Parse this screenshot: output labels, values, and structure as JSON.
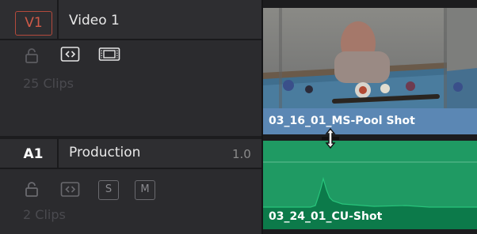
{
  "video_track": {
    "badge": "V1",
    "name": "Video 1",
    "clip_count": "25 Clips",
    "clip": {
      "label": "03_16_01_MS-Pool Shot"
    }
  },
  "audio_track": {
    "badge": "A1",
    "name": "Production",
    "level": "1.0",
    "clip_count": "2 Clips",
    "solo_label": "S",
    "mute_label": "M",
    "clip": {
      "label": "03_24_01_CU-Shot"
    }
  },
  "icons": {
    "lock": "lock-icon",
    "auto_select": "auto-select-icon",
    "video_enable": "film-strip-icon",
    "cursor": "trim-cursor-icon"
  },
  "colors": {
    "v1_badge": "#cf5a48",
    "video_clip": "#5b87b4",
    "audio_clip": "#1f9a63"
  }
}
